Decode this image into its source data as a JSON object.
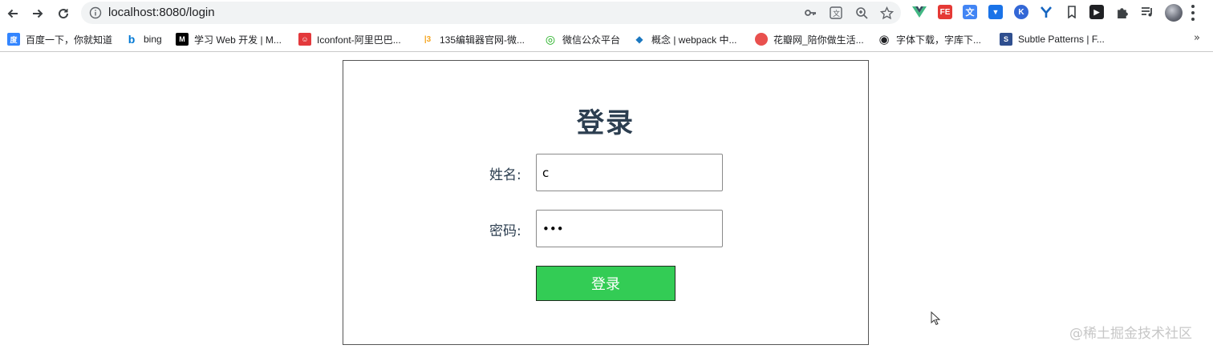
{
  "browser": {
    "url": "localhost:8080/login",
    "extensions": [
      {
        "name": "vue-devtools-icon",
        "text": "V",
        "color": "#41b883"
      },
      {
        "name": "fe-helper-icon",
        "text": "FE",
        "color": "#e53935"
      },
      {
        "name": "translate-extension-icon",
        "text": "文",
        "color": "#4285f4"
      },
      {
        "name": "save-extension-icon",
        "text": "▼",
        "color": "#1a73e8"
      },
      {
        "name": "k-extension-icon",
        "text": "K",
        "color": "#3367d6"
      },
      {
        "name": "y-extension-icon",
        "text": "Y",
        "color": "#1565c0"
      }
    ]
  },
  "bookmarks": [
    {
      "label": "百度一下，你就知道",
      "icon": "baidu-icon",
      "color": "#3385ff",
      "glyph": "度"
    },
    {
      "label": "bing",
      "icon": "bing-icon",
      "color": "#0078d4",
      "glyph": "b"
    },
    {
      "label": "学习 Web 开发 | M...",
      "icon": "mdn-icon",
      "color": "#000000",
      "glyph": "M"
    },
    {
      "label": "Iconfont-阿里巴巴...",
      "icon": "iconfont-icon",
      "color": "#e3393c",
      "glyph": "☺"
    },
    {
      "label": "135编辑器官网-微...",
      "icon": "editor135-icon",
      "color": "#f5a623",
      "glyph": "|3"
    },
    {
      "label": "微信公众平台",
      "icon": "wechat-mp-icon",
      "color": "#1aad19",
      "glyph": "◎"
    },
    {
      "label": "概念 | webpack 中...",
      "icon": "webpack-icon",
      "color": "#8dd6f9",
      "glyph": "◆"
    },
    {
      "label": "花瓣网_陪你做生活...",
      "icon": "huaban-icon",
      "color": "#e9504e",
      "glyph": "花"
    },
    {
      "label": "字体下载，字库下...",
      "icon": "globe-icon",
      "color": "#202124",
      "glyph": "◉"
    },
    {
      "label": "Subtle Patterns | F...",
      "icon": "subtle-patterns-icon",
      "color": "#2f4f8f",
      "glyph": "S"
    }
  ],
  "login": {
    "title": "登录",
    "name_label": "姓名:",
    "name_value": "c",
    "password_label": "密码:",
    "password_value": "abc",
    "submit_label": "登录"
  },
  "watermark": "@稀土掘金技术社区",
  "colors": {
    "title": "#2c3e50",
    "submit_bg": "#33cc55"
  }
}
